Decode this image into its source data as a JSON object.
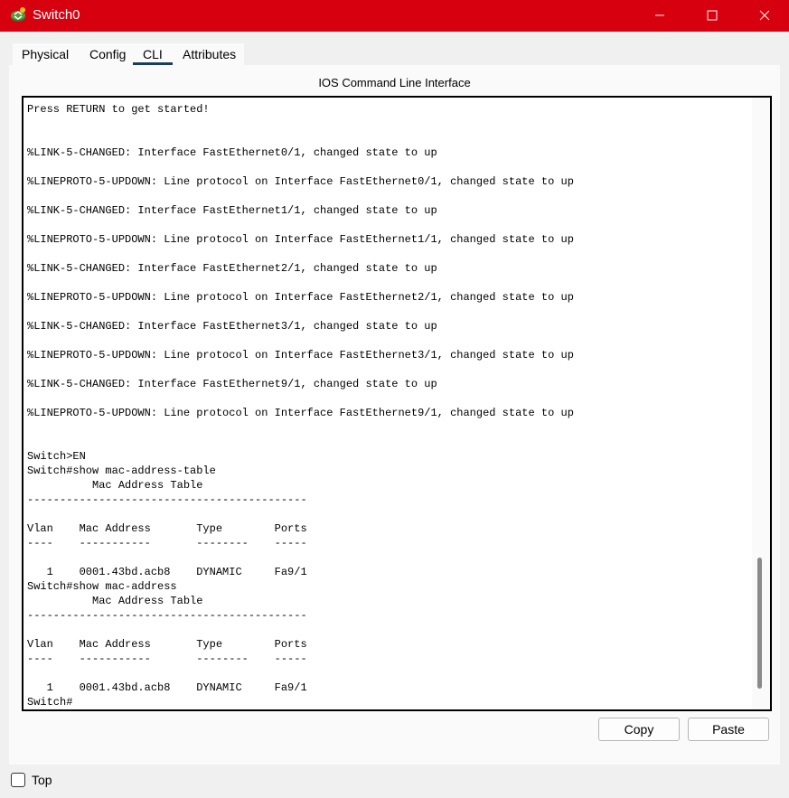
{
  "window": {
    "title": "Switch0",
    "app_icon": "router-icon",
    "controls": [
      "minimize-icon",
      "maximize-icon",
      "close-icon"
    ],
    "title_bar_color": "#d7000f"
  },
  "tabs": [
    {
      "label": "Physical",
      "selected": false
    },
    {
      "label": "Config",
      "selected": false
    },
    {
      "label": "CLI",
      "selected": true
    },
    {
      "label": "Attributes",
      "selected": false
    }
  ],
  "cli": {
    "title": "IOS Command Line Interface",
    "lines": [
      "Press RETURN to get started!",
      "",
      "",
      "%LINK-5-CHANGED: Interface FastEthernet0/1, changed state to up",
      "",
      "%LINEPROTO-5-UPDOWN: Line protocol on Interface FastEthernet0/1, changed state to up",
      "",
      "%LINK-5-CHANGED: Interface FastEthernet1/1, changed state to up",
      "",
      "%LINEPROTO-5-UPDOWN: Line protocol on Interface FastEthernet1/1, changed state to up",
      "",
      "%LINK-5-CHANGED: Interface FastEthernet2/1, changed state to up",
      "",
      "%LINEPROTO-5-UPDOWN: Line protocol on Interface FastEthernet2/1, changed state to up",
      "",
      "%LINK-5-CHANGED: Interface FastEthernet3/1, changed state to up",
      "",
      "%LINEPROTO-5-UPDOWN: Line protocol on Interface FastEthernet3/1, changed state to up",
      "",
      "%LINK-5-CHANGED: Interface FastEthernet9/1, changed state to up",
      "",
      "%LINEPROTO-5-UPDOWN: Line protocol on Interface FastEthernet9/1, changed state to up",
      "",
      "",
      "Switch>EN",
      "Switch#show mac-address-table",
      "          Mac Address Table",
      "-------------------------------------------",
      "",
      "Vlan    Mac Address       Type        Ports",
      "----    -----------       --------    -----",
      "",
      "   1    0001.43bd.acb8    DYNAMIC     Fa9/1",
      "Switch#show mac-address",
      "          Mac Address Table",
      "-------------------------------------------",
      "",
      "Vlan    Mac Address       Type        Ports",
      "----    -----------       --------    -----",
      "",
      "   1    0001.43bd.acb8    DYNAMIC     Fa9/1",
      "Switch#"
    ]
  },
  "buttons": {
    "copy": "Copy",
    "paste": "Paste"
  },
  "footer": {
    "top_label": "Top",
    "top_checked": false
  }
}
